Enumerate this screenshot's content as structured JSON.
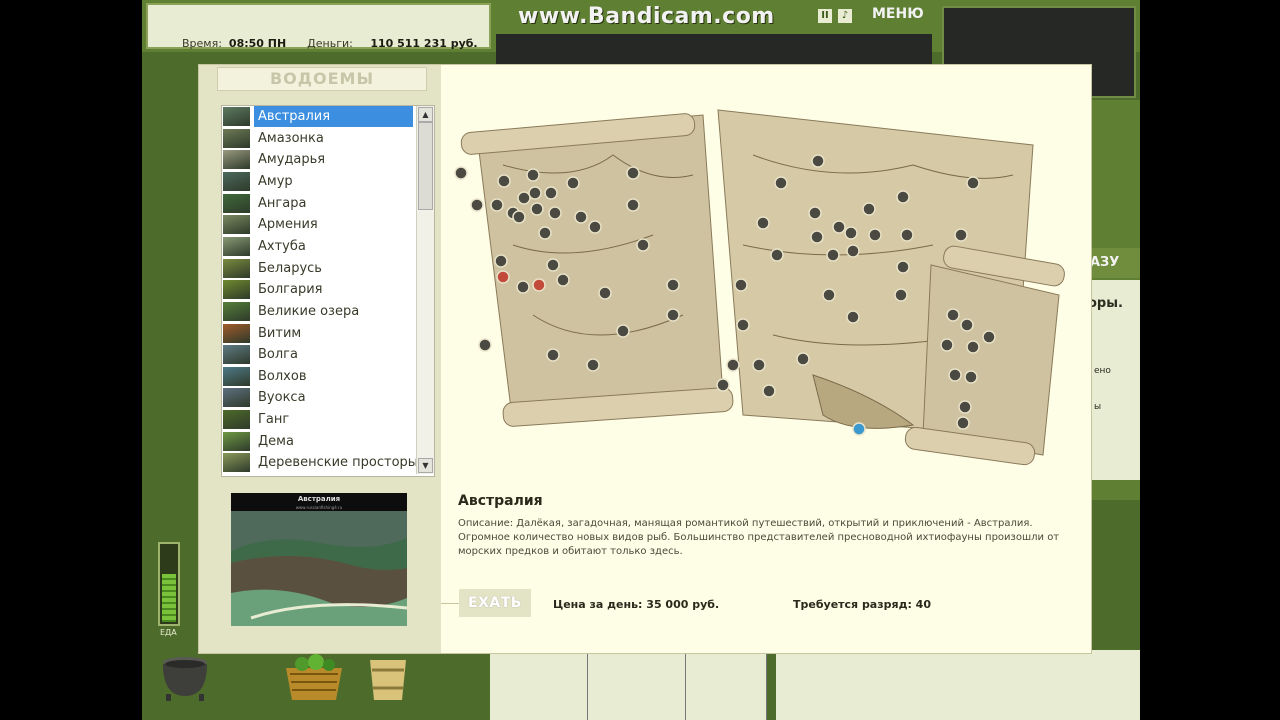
{
  "topbar": {
    "time_label": "Время:",
    "time_value": "08:50 ПН",
    "money_label": "Деньги:",
    "money_value": "110 511 231 руб.",
    "watermark": "www.Bandicam.com",
    "menu_label": "МЕНЮ",
    "icons": [
      "pause-icon",
      "sound-icon"
    ]
  },
  "background": {
    "right_button_label": "АЗУ",
    "right_text_1": "оры.",
    "right_text_2": "ено",
    "right_text_3": "ы",
    "meter_label": "ЕДА",
    "meter_level": 0.6
  },
  "dialog": {
    "tab_label": "ВОДОЕМЫ",
    "lakes": [
      {
        "name": "Австралия",
        "color": "#5d7a62",
        "selected": true
      },
      {
        "name": "Амазонка",
        "color": "#6e7a55"
      },
      {
        "name": "Амударья",
        "color": "#9a9a80"
      },
      {
        "name": "Амур",
        "color": "#4c6a5e"
      },
      {
        "name": "Ангара",
        "color": "#3f6a3a"
      },
      {
        "name": "Армения",
        "color": "#7a8a60"
      },
      {
        "name": "Ахтуба",
        "color": "#8a9a75"
      },
      {
        "name": "Беларусь",
        "color": "#7a8c3e"
      },
      {
        "name": "Болгария",
        "color": "#6f8a2e"
      },
      {
        "name": "Великие озера",
        "color": "#557f3a"
      },
      {
        "name": "Витим",
        "color": "#a05a2a"
      },
      {
        "name": "Волга",
        "color": "#5f7a85"
      },
      {
        "name": "Волхов",
        "color": "#4e7a88"
      },
      {
        "name": "Вуокса",
        "color": "#5f7080"
      },
      {
        "name": "Ганг",
        "color": "#4e6a2a"
      },
      {
        "name": "Дема",
        "color": "#6f9a45"
      },
      {
        "name": "Деревенские просторы",
        "color": "#8a9a5a"
      }
    ],
    "preview_title": "Австралия",
    "preview_subtitle": "www.russianfishing4.ru",
    "lake_title": "Австралия",
    "description": "Описание: Далёкая, загадочная, манящая романтикой путешествий, открытий и приключений - Австралия. Огромное количество новых видов рыб. Большинство представителей пресноводной ихтиофауны произошли от морских предков и обитают только здесь.",
    "go_button": "ЕХАТЬ",
    "price_text": "Цена за день: 35 000 руб.",
    "rank_text": "Требуется разряд: 40",
    "map_name": "world-map-scroll"
  }
}
